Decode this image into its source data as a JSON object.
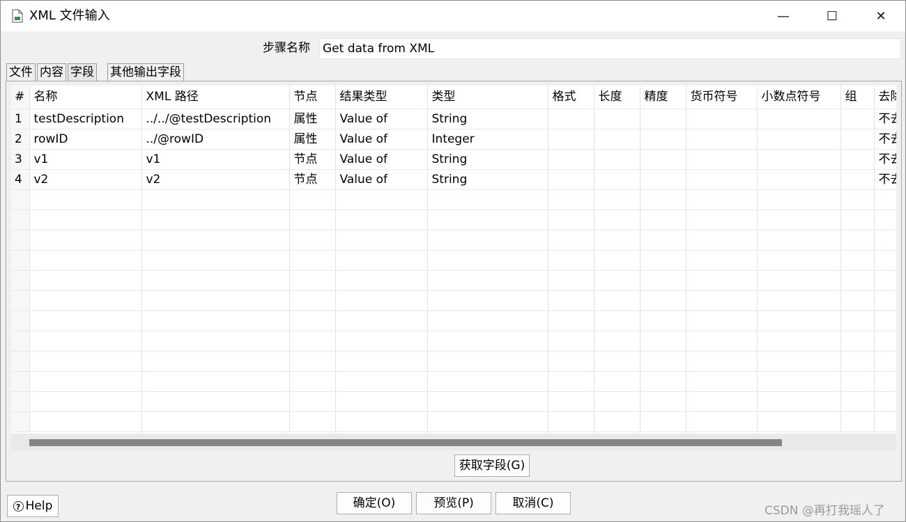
{
  "window": {
    "title": "XML 文件输入",
    "minimize_glyph": "—",
    "maximize_glyph": "☐",
    "close_glyph": "✕"
  },
  "step": {
    "label": "步骤名称",
    "value": "Get data from XML"
  },
  "tabs": [
    {
      "label": "文件"
    },
    {
      "label": "内容"
    },
    {
      "label": "字段"
    },
    {
      "label": "其他输出字段"
    }
  ],
  "table": {
    "headers": {
      "idx": "#",
      "name": "名称",
      "xpath": "XML 路径",
      "node": "节点",
      "result_type": "结果类型",
      "type": "类型",
      "format": "格式",
      "length": "长度",
      "precision": "精度",
      "currency": "货币符号",
      "decimal": "小数点符号",
      "group": "组",
      "trim": "去除"
    },
    "rows": [
      {
        "idx": "1",
        "name": "testDescription",
        "xpath": "../../@testDescription",
        "node": "属性",
        "result_type": "Value of",
        "type": "String",
        "trim": "不去"
      },
      {
        "idx": "2",
        "name": "rowID",
        "xpath": "../@rowID",
        "node": "属性",
        "result_type": "Value of",
        "type": "Integer",
        "trim": "不去"
      },
      {
        "idx": "3",
        "name": "v1",
        "xpath": "v1",
        "node": "节点",
        "result_type": "Value of",
        "type": "String",
        "trim": "不去"
      },
      {
        "idx": "4",
        "name": "v2",
        "xpath": "v2",
        "node": "节点",
        "result_type": "Value of",
        "type": "String",
        "trim": "不去"
      }
    ]
  },
  "buttons": {
    "get_fields": "获取字段(G)",
    "ok": "确定(O)",
    "preview": "预览(P)",
    "cancel": "取消(C)",
    "help": "Help"
  },
  "watermark": "CSDN @再打我瑶人了"
}
